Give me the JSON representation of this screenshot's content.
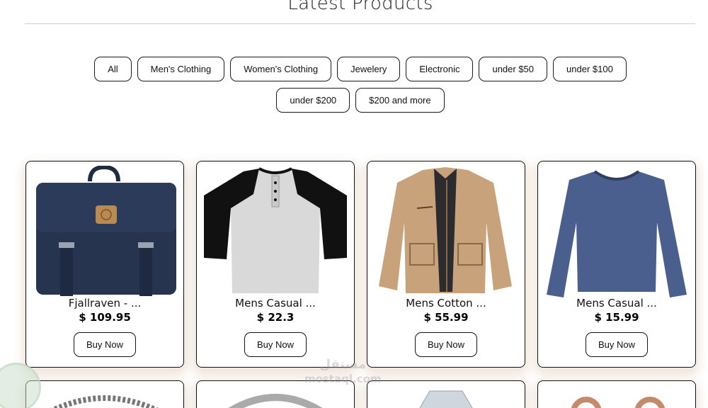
{
  "page": {
    "title": "Latest Products"
  },
  "filters": [
    {
      "label": "All"
    },
    {
      "label": "Men's Clothing"
    },
    {
      "label": "Women's Clothing"
    },
    {
      "label": "Jewelery"
    },
    {
      "label": "Electronic"
    },
    {
      "label": "under $50"
    },
    {
      "label": "under $100"
    },
    {
      "label": "under $200"
    },
    {
      "label": "$200 and more"
    }
  ],
  "products": [
    {
      "name": "Fjallraven - ...",
      "price": "$ 109.95",
      "button": "Buy Now",
      "icon": "backpack-image"
    },
    {
      "name": "Mens Casual ...",
      "price": "$ 22.3",
      "button": "Buy Now",
      "icon": "raglan-tshirt-image"
    },
    {
      "name": "Mens Cotton ...",
      "price": "$ 55.99",
      "button": "Buy Now",
      "icon": "jacket-image"
    },
    {
      "name": "Mens Casual ...",
      "price": "$ 15.99",
      "button": "Buy Now",
      "icon": "longsleeve-shirt-image"
    }
  ],
  "watermark": {
    "arabic": "مستقل",
    "latin": "mostaql.com"
  },
  "colors": {
    "navy": "#26344f",
    "tan": "#c7a27a",
    "blue_shirt": "#4a5f8e",
    "shadow": "#cdaa8c"
  }
}
